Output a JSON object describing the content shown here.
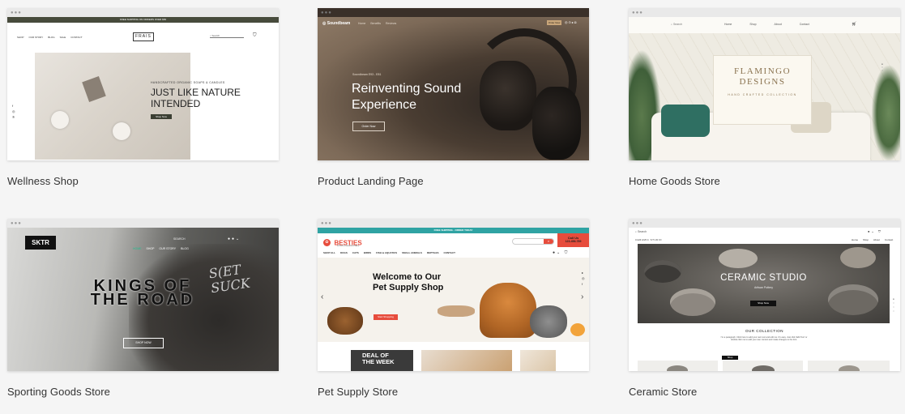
{
  "templates": [
    {
      "caption": "Wellness Shop",
      "site": {
        "banner": "FREE SHIPPING ON ORDERS OVER $50",
        "nav": [
          "SHOP",
          "OUR STORY",
          "BLOG",
          "SALE",
          "CONTACT"
        ],
        "logo": "FRAIS",
        "search_label": "Search",
        "hero_kicker": "HANDCRAFTED ORGANIC SOAPS & CANDLES",
        "hero_title": "JUST LIKE NATURE INTENDED",
        "cta": "Shop Now"
      }
    },
    {
      "caption": "Product Landing Page",
      "site": {
        "logo": "Soundbeam",
        "nav": [
          "Home",
          "Benefits",
          "Reviews"
        ],
        "buy": "Order Now",
        "model": "Soundbeam E93 - E81",
        "hero_title": "Reinventing Sound Experience",
        "cta": "Order Now"
      }
    },
    {
      "caption": "Home Goods Store",
      "site": {
        "search_label": "Search",
        "nav": [
          "Home",
          "Shop",
          "About",
          "Contact"
        ],
        "brand": "FLAMINGO DESIGNS",
        "tagline": "HAND CRAFTED COLLECTION"
      }
    },
    {
      "caption": "Sporting Goods Store",
      "site": {
        "logo": "SKTR",
        "search_label": "SEARCH",
        "nav": [
          "HOME",
          "SHOP",
          "OUR STORY",
          "BLOG"
        ],
        "hero_title": "KINGS OF THE ROAD",
        "cta": "SHOP NOW"
      }
    },
    {
      "caption": "Pet Supply Store",
      "site": {
        "banner": "FREE SHIPPING - ORDER TODAY",
        "logo": "BESTIES",
        "logo_sub": "A Pet's Favorite Place",
        "call_label": "Call Us",
        "call_number": "123-456-789",
        "nav": [
          "SHOP ALL",
          "DOGS",
          "CATS",
          "BIRDS",
          "FISH & AQUATICS",
          "SMALL ANIMALS",
          "REPTILES",
          "CONTACT"
        ],
        "hero_title": "Welcome to Our Pet Supply Shop",
        "cta": "Start Shopping",
        "deal": "DEAL OF THE WEEK"
      }
    },
    {
      "caption": "Ceramic Store",
      "site": {
        "search_label": "Search",
        "logo": "CERAMIC STUDIO",
        "nav": [
          "Home",
          "Shop",
          "About",
          "Contact"
        ],
        "hero_title": "CERAMIC STUDIO",
        "hero_sub": "Artisan Pottery",
        "cta": "Shop Now",
        "collection_title": "OUR COLLECTION",
        "collection_text": "I'm a paragraph. Click here to add your own text and edit me. It's easy. Just click 'Edit Text' or double click me to add your own content and make changes to the font.",
        "collection_cta": "Shop"
      }
    }
  ],
  "colors": {
    "page_bg": "#f5f5f5",
    "caption": "#333333",
    "frais_banner": "#474b3c",
    "soundbeam_bg": "#5a4a3c",
    "besties_red": "#e74c3c",
    "besties_banner": "#2fa3a3",
    "sktr_green": "#1fbf8f"
  }
}
